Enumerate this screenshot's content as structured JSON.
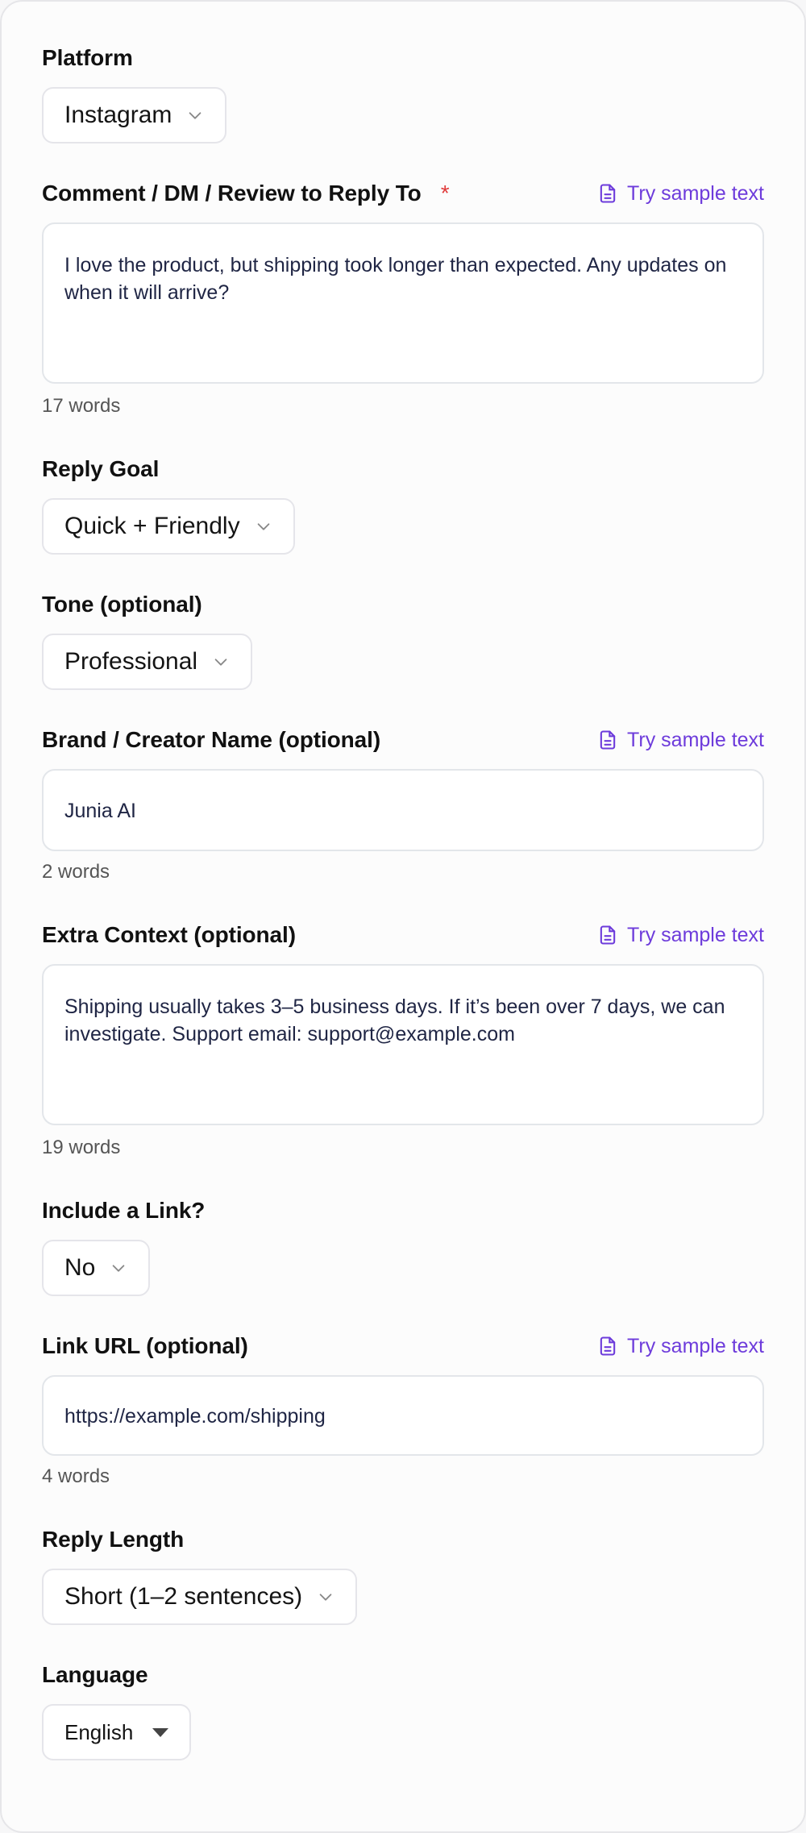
{
  "platform": {
    "label": "Platform",
    "value": "Instagram"
  },
  "comment": {
    "label": "Comment / DM / Review to Reply To",
    "required_mark": "*",
    "sample_label": "Try sample text",
    "value": "I love the product, but shipping took longer than expected. Any updates on when it will arrive?",
    "word_count": "17 words"
  },
  "reply_goal": {
    "label": "Reply Goal",
    "value": "Quick + Friendly"
  },
  "tone": {
    "label": "Tone (optional)",
    "value": "Professional"
  },
  "brand": {
    "label": "Brand / Creator Name (optional)",
    "sample_label": "Try sample text",
    "value": "Junia AI",
    "word_count": "2 words"
  },
  "extra_context": {
    "label": "Extra Context (optional)",
    "sample_label": "Try sample text",
    "value": "Shipping usually takes 3–5 business days. If it’s been over 7 days, we can investigate. Support email: support@example.com",
    "word_count": "19 words"
  },
  "include_link": {
    "label": "Include a Link?",
    "value": "No"
  },
  "link_url": {
    "label": "Link URL (optional)",
    "sample_label": "Try sample text",
    "value": "https://example.com/shipping",
    "word_count": "4 words"
  },
  "reply_length": {
    "label": "Reply Length",
    "value": "Short (1–2 sentences)"
  },
  "language": {
    "label": "Language",
    "value": "English"
  },
  "colors": {
    "accent": "#6d3bdb",
    "required": "#e03a3a",
    "border": "#e5e5ea"
  }
}
